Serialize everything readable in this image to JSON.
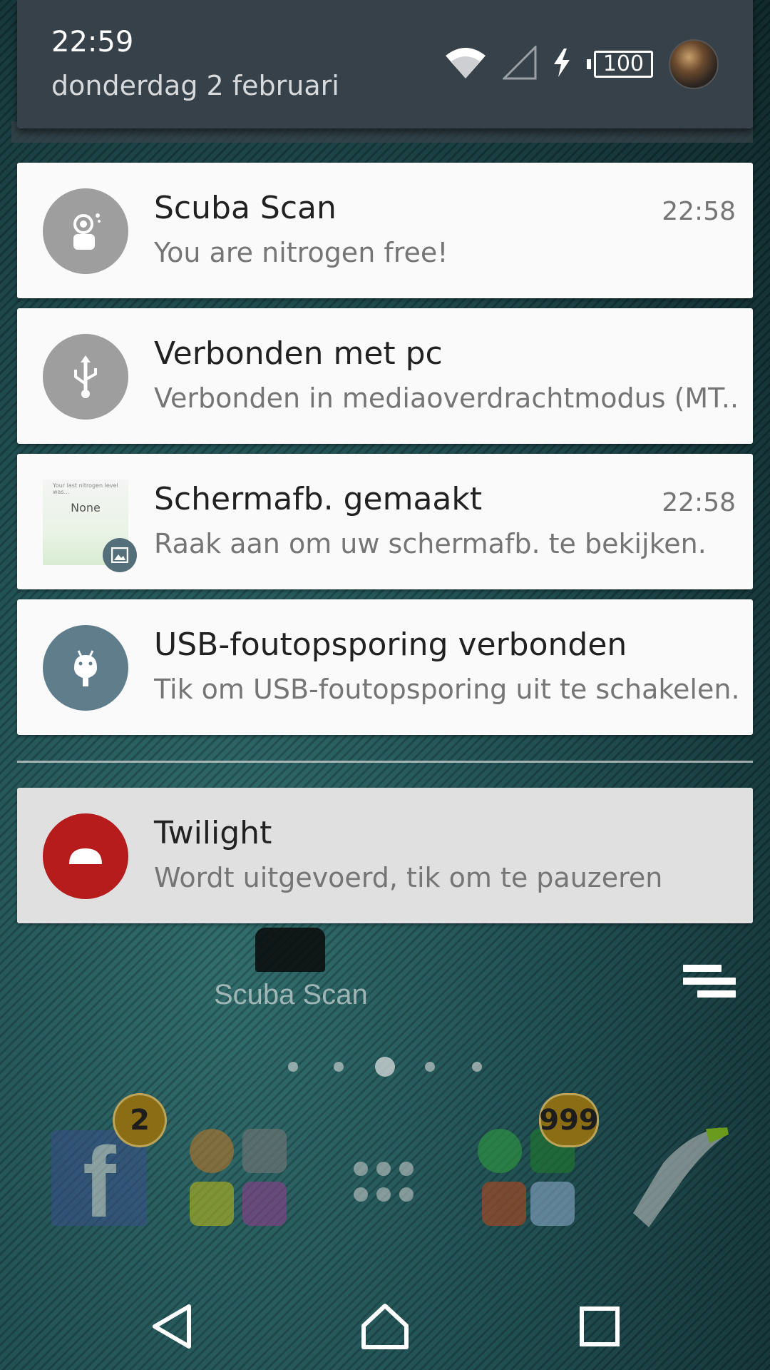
{
  "status": {
    "time": "22:59",
    "date": "donderdag 2 februari",
    "battery": "100",
    "icons": [
      "wifi-icon",
      "signal-icon",
      "charging-icon",
      "battery-icon",
      "user-avatar"
    ]
  },
  "notifications": [
    {
      "app": "Scuba Scan",
      "title": "Scuba Scan",
      "text": "You are nitrogen free!",
      "time": "22:58",
      "icon": "scuba-diver-icon",
      "icon_bg": "#9e9e9e"
    },
    {
      "app": "USB",
      "title": "Verbonden met pc",
      "text": "Verbonden in mediaoverdrachtmodus (MT..",
      "time": "",
      "icon": "usb-icon",
      "icon_bg": "#9e9e9e"
    },
    {
      "app": "Screenshot",
      "title": "Schermafb. gemaakt",
      "text": "Raak aan om uw schermafb. te bekijken.",
      "time": "22:58",
      "icon": "screenshot-thumbnail",
      "thumb_top": "Your last nitrogen level was...",
      "thumb_value": "None"
    },
    {
      "app": "USB debugging",
      "title": "USB-foutopsporing verbonden",
      "text": "Tik om USB-foutopsporing uit te schakelen.",
      "time": "",
      "icon": "android-icon",
      "icon_bg": "#607d8b"
    },
    {
      "app": "Twilight",
      "title": "Twilight",
      "text": "Wordt uitgevoerd, tik om te pauzeren",
      "time": "",
      "icon": "twilight-icon",
      "icon_bg": "#b71c1c"
    }
  ],
  "home": {
    "app_label": "Scuba Scan",
    "facebook_badge": "2",
    "messaging_badge": "999",
    "page_count": 5,
    "active_page": 3
  },
  "navbar": {
    "back": "back-icon",
    "home": "home-icon",
    "recents": "recents-icon"
  },
  "colors": {
    "status_panel": "#37414a",
    "card": "#fafafa",
    "twilight_card": "#e0e0e0",
    "twilight_accent": "#b71c1c"
  }
}
